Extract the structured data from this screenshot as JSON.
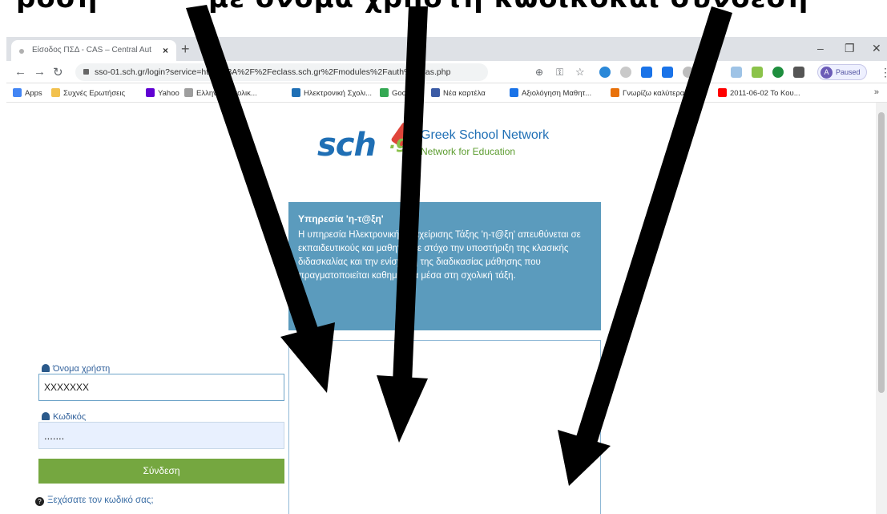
{
  "browser": {
    "tab_title": "Είσοδος ΠΣΔ - CAS – Central Aut",
    "tab_close": "×",
    "new_tab": "+",
    "url": "sso-01.sch.gr/login?service=https%3A%2F%2Feclass.sch.gr%2Fmodules%2Fauth%2Fcas.php",
    "profile_status": "Paused",
    "profile_initial": "A"
  },
  "bookmarks": [
    {
      "label": "Apps",
      "color": "#4285f4"
    },
    {
      "label": "Συχνές Ερωτήσεις",
      "color": "#f2c14e"
    },
    {
      "label": "Yahoo",
      "color": "#6001d2"
    },
    {
      "label": "Ελληνικό Σχολικ...",
      "color": "#9e9e9e"
    },
    {
      "label": "Ηλεκτρονική Σχολι...",
      "color": "#1f6fb5"
    },
    {
      "label": "Google",
      "color": "#34a853"
    },
    {
      "label": "Νέα καρτέλα",
      "color": "#3b5ba5"
    },
    {
      "label": "Αξιολόγηση Μαθητ...",
      "color": "#1a73e8"
    },
    {
      "label": "Γνωρίζω καλύτερα...",
      "color": "#e8710a"
    },
    {
      "label": "2011-06-02 Το Κου...",
      "color": "#ff0000"
    }
  ],
  "logo": {
    "mark_text": "sch",
    "mark_suffix": ".gr",
    "title": "Greek School Network",
    "subtitle": "Network for Education"
  },
  "info": {
    "title": "Υπηρεσία 'η-τ@ξη'",
    "body": "Η υπηρεσία Ηλεκτρονικής Διαχείρισης Τάξης 'η-τ@ξη' απευθύνεται σε εκπαιδευτικούς και μαθητές με στόχο την υποστήριξη της κλασικής διδασκαλίας και την ενίσχυση της διαδικασίας μάθησης που πραγματοποιείται καθημερινά μέσα στη σχολική τάξη."
  },
  "form": {
    "username_label": "Όνομα χρήστη",
    "username_value": "XXXXXXX",
    "password_label": "Κωδικός",
    "password_value": ".......",
    "login_label": "Σύνδεση",
    "forgot_label": "Ξεχάσατε τον κωδικό σας;"
  },
  "colors": {
    "info_bg": "#5b9bbd",
    "login_bg": "#75a740",
    "arrow": "#000000"
  }
}
